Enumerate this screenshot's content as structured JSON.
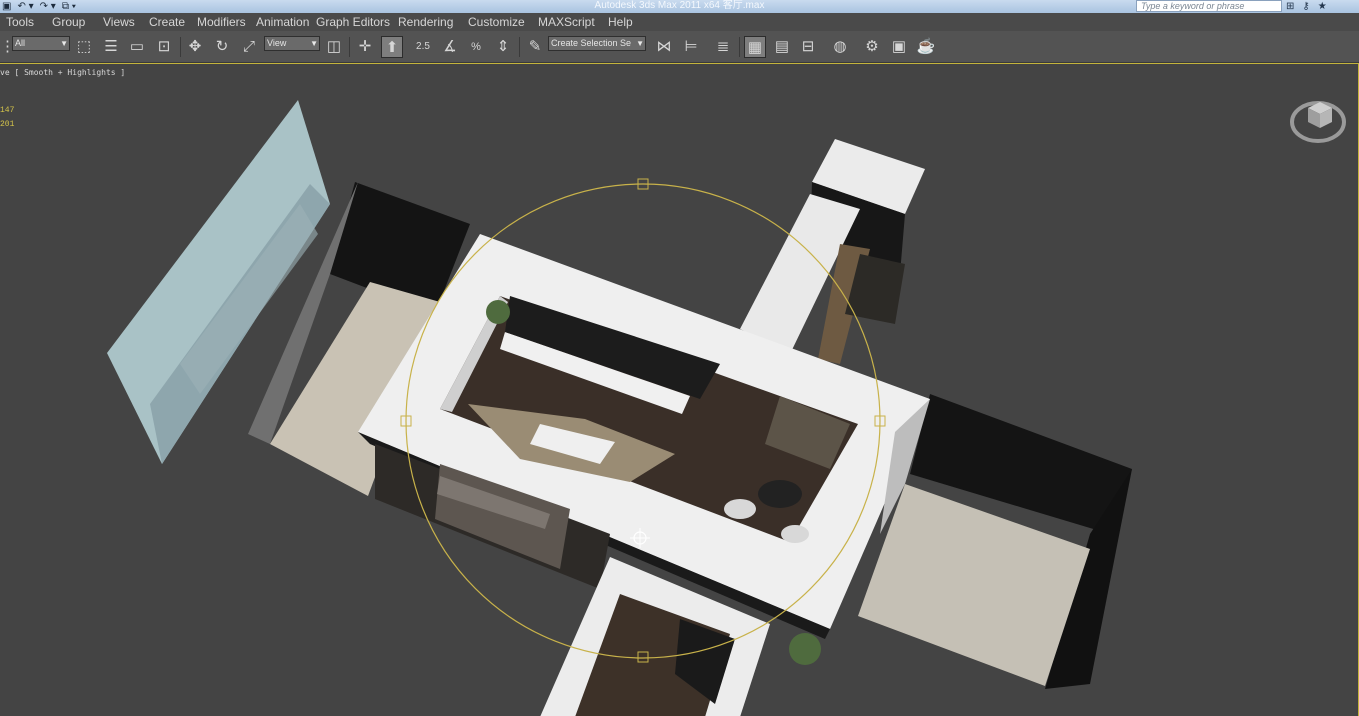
{
  "app": {
    "title": "Autodesk 3ds Max  2011 x64    客厅.max",
    "search_placeholder": "Type a keyword or phrase"
  },
  "menu": [
    "Tools",
    "Group",
    "Views",
    "Create",
    "Modifiers",
    "Animation",
    "Graph Editors",
    "Rendering",
    "Customize",
    "MAXScript",
    "Help"
  ],
  "toolbar": {
    "selection_filter": "All",
    "reference_coord": "View",
    "named_selection": "Create Selection Se",
    "snap_label": "2.5"
  },
  "viewport": {
    "label": "Perspective [ Smooth + Highlights ]",
    "label_visible": "ve [ Smooth + Highlights ]",
    "stats": [
      "147",
      "201"
    ]
  },
  "colors": {
    "accent": "#c4b43c",
    "viewport_bg": "#444444",
    "gizmo": "#c8b24a"
  }
}
